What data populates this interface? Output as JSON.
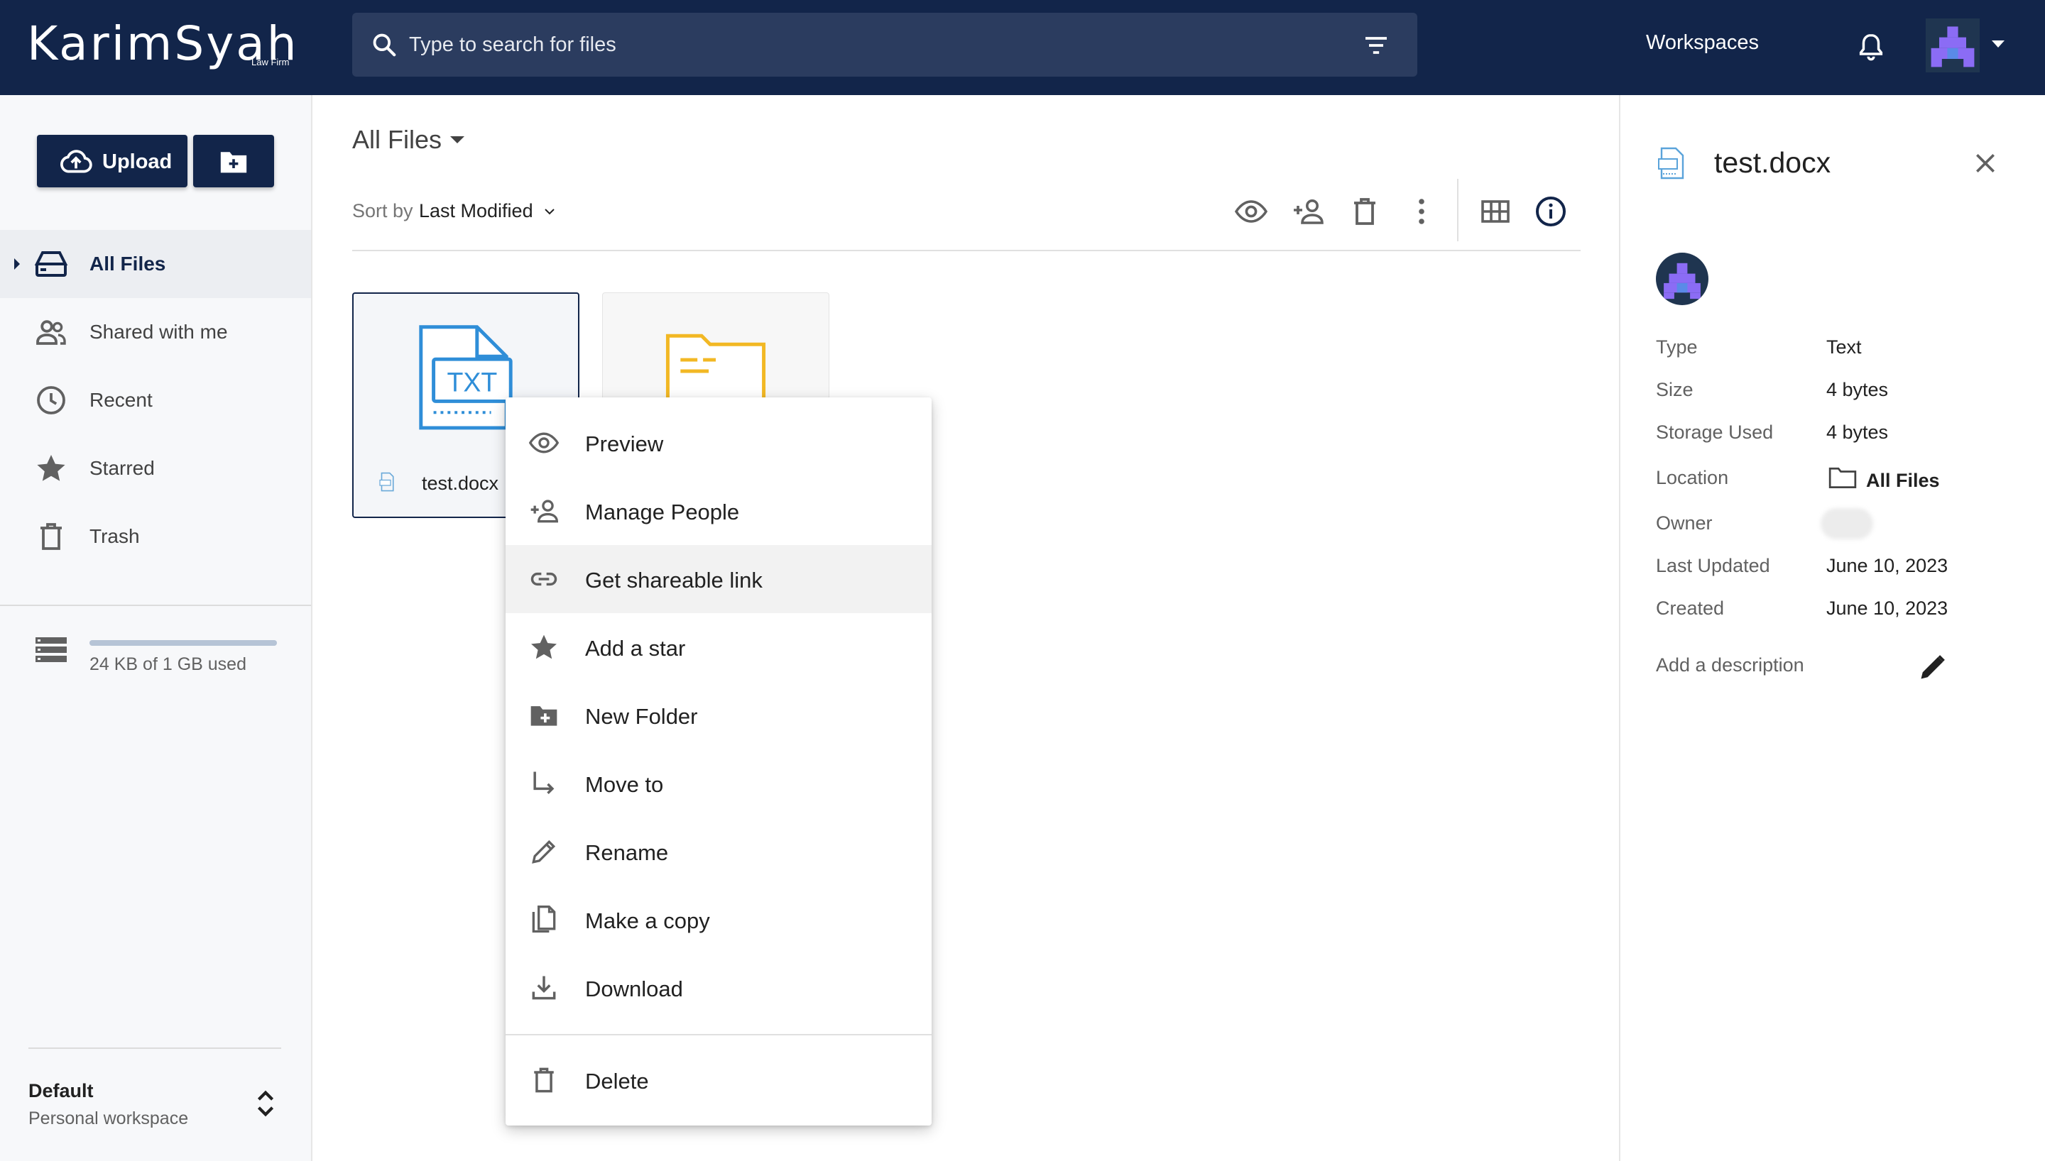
{
  "header": {
    "logo_text": "KarimSyah",
    "logo_subtext": "Law Firm",
    "search_placeholder": "Type to search for files",
    "workspaces_label": "Workspaces",
    "icons": [
      "search-icon",
      "filter-icon",
      "bell-icon",
      "avatar",
      "chevron-down-icon"
    ]
  },
  "sidebar": {
    "upload_label": "Upload",
    "nav": [
      {
        "label": "All Files",
        "icon": "drive-icon",
        "active": true
      },
      {
        "label": "Shared with me",
        "icon": "people-icon"
      },
      {
        "label": "Recent",
        "icon": "clock-icon"
      },
      {
        "label": "Starred",
        "icon": "star-icon"
      },
      {
        "label": "Trash",
        "icon": "trash-icon"
      }
    ],
    "storage_text": "24 KB of 1 GB used",
    "storage_fraction": 2e-05,
    "workspace_name": "Default",
    "workspace_sub": "Personal workspace"
  },
  "main": {
    "title": "All Files",
    "sort_label": "Sort by",
    "sort_value": "Last Modified",
    "toolbar_icons": [
      "eye-icon",
      "add-person-icon",
      "trash-icon",
      "more-vert-icon",
      "grid-view-icon",
      "info-icon"
    ],
    "files": [
      {
        "name": "test.docx",
        "type": "TXT",
        "selected": true
      },
      {
        "name": "",
        "type": "folder"
      }
    ],
    "thumb_label": "TXT"
  },
  "context_menu": {
    "items": [
      {
        "label": "Preview",
        "icon": "eye-icon"
      },
      {
        "label": "Manage People",
        "icon": "add-person-icon"
      },
      {
        "label": "Get shareable link",
        "icon": "link-icon",
        "hover": true
      },
      {
        "label": "Add a star",
        "icon": "star-icon"
      },
      {
        "label": "New Folder",
        "icon": "new-folder-icon"
      },
      {
        "label": "Move to",
        "icon": "move-icon"
      },
      {
        "label": "Rename",
        "icon": "pencil-icon"
      },
      {
        "label": "Make a copy",
        "icon": "copy-icon"
      },
      {
        "label": "Download",
        "icon": "download-icon"
      },
      {
        "label": "Delete",
        "icon": "trash-icon"
      }
    ]
  },
  "details": {
    "title": "test.docx",
    "rows": [
      {
        "label": "Type",
        "value": "Text"
      },
      {
        "label": "Size",
        "value": "4 bytes"
      },
      {
        "label": "Storage Used",
        "value": "4 bytes"
      },
      {
        "label": "Location",
        "value": "All Files"
      },
      {
        "label": "Owner",
        "value": ""
      },
      {
        "label": "Last Updated",
        "value": "June 10, 2023"
      },
      {
        "label": "Created",
        "value": "June 10, 2023"
      }
    ],
    "description_label": "Add a description"
  },
  "colors": {
    "header_bg": "#12254a",
    "accent": "#12254a",
    "txt_icon": "#2f8ed8",
    "folder_icon": "#f2b824",
    "avatar_purple": "#7b5cf0"
  }
}
